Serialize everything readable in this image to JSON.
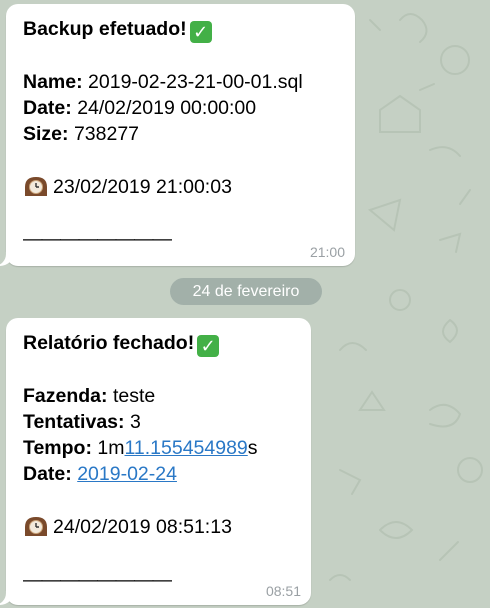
{
  "chat": {
    "date_separator": "24 de fevereiro",
    "messages": [
      {
        "title": "Backup efetuado!",
        "fields": [
          {
            "label": "Name",
            "value": "2019-02-23-21-00-01.sql"
          },
          {
            "label": "Date",
            "value": "24/02/2019 00:00:00"
          },
          {
            "label": "Size",
            "value": "738277"
          }
        ],
        "clock_line": "23/02/2019 21:00:03",
        "separator": "————————",
        "time": "21:00"
      },
      {
        "title": "Relatório fechado!",
        "fazenda_label": "Fazenda",
        "fazenda_value": "teste",
        "tentativas_label": "Tentativas",
        "tentativas_value": "3",
        "tempo_label": "Tempo",
        "tempo_prefix": "1m",
        "tempo_link": "11.155454989",
        "tempo_suffix": "s",
        "date_label": "Date",
        "date_link": "2019-02-24",
        "clock_line": "24/02/2019 08:51:13",
        "separator": "————————",
        "time": "08:51"
      }
    ]
  },
  "colors": {
    "background": "#c5d0c4",
    "bubble": "#ffffff",
    "link": "#2a78c6",
    "check_emoji": "#43b047",
    "time_text": "#9aa0a4"
  },
  "icons": [
    "check-mark-emoji",
    "mantel-clock-emoji"
  ]
}
